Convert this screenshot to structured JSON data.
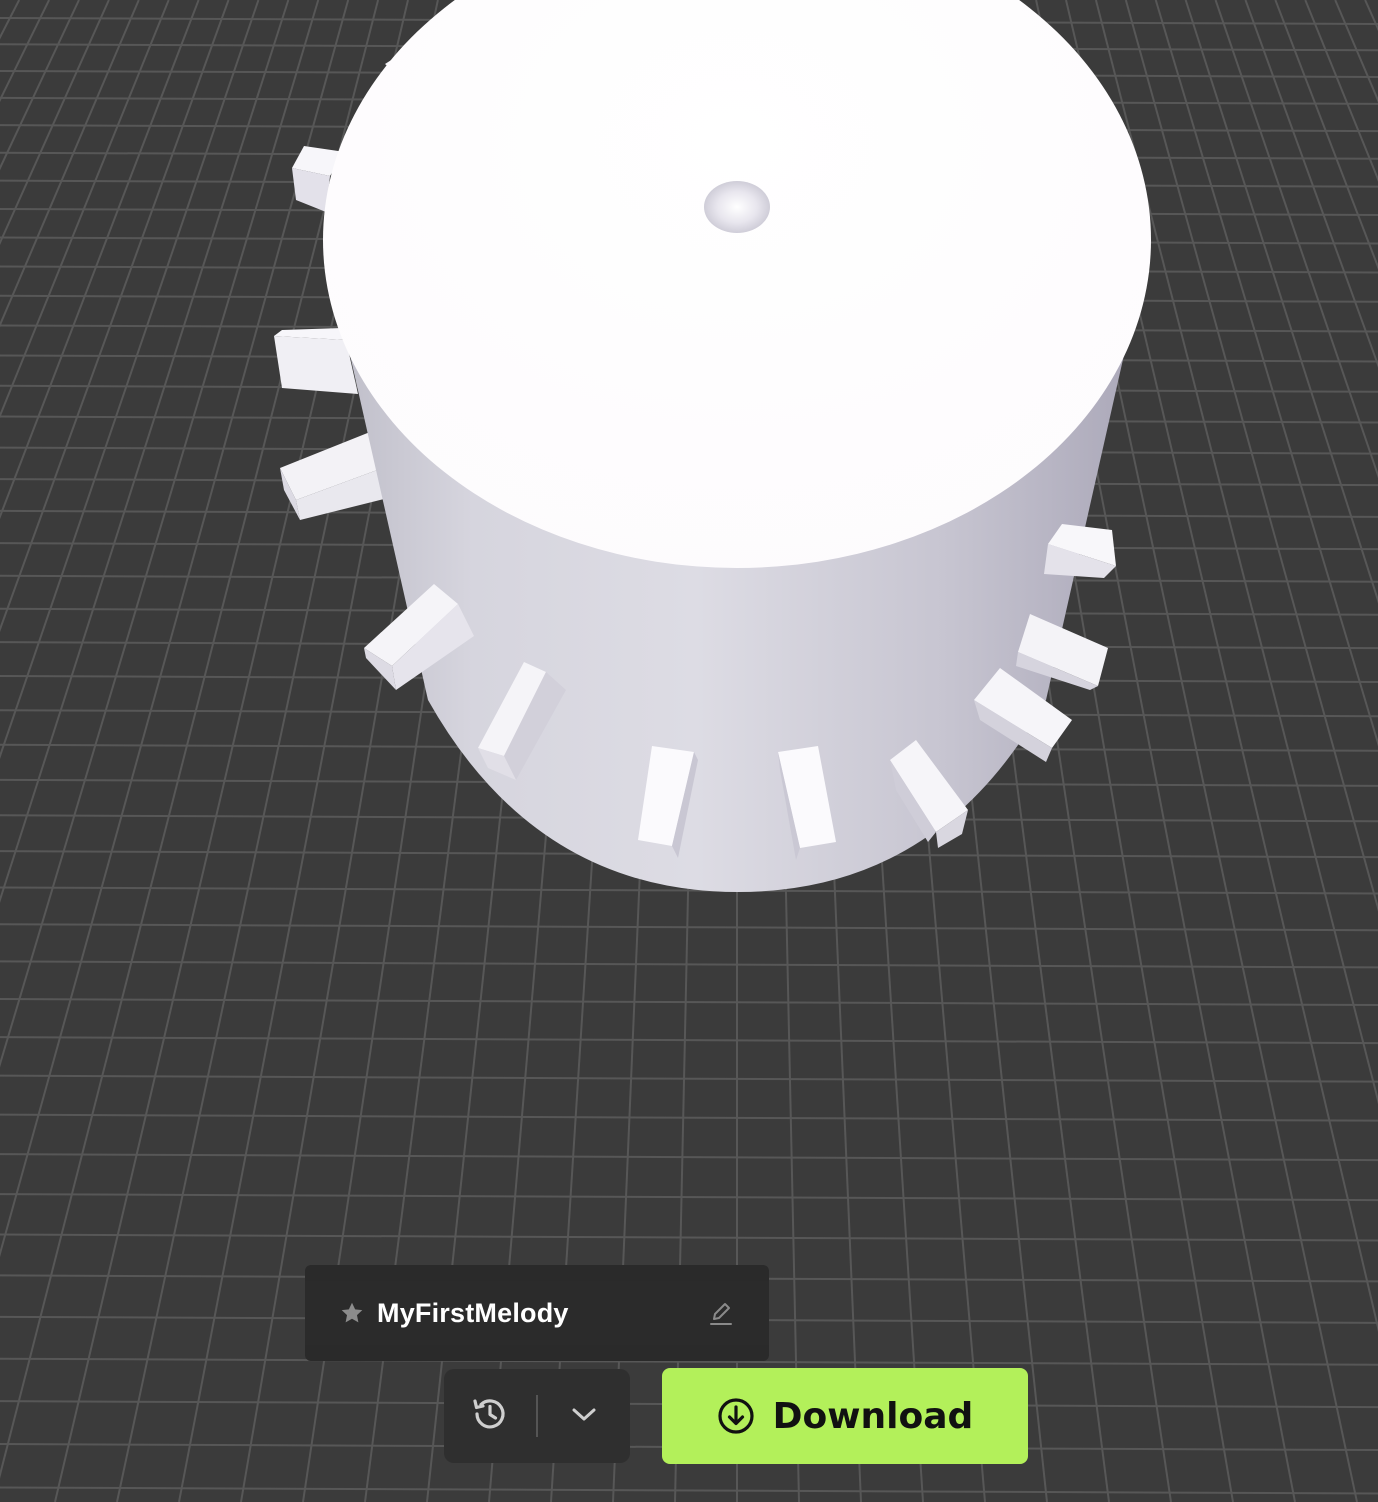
{
  "project": {
    "name": "MyFirstMelody",
    "starred": false
  },
  "toolbar": {
    "download_label": "Download"
  },
  "icons": {
    "favorite": "star-icon",
    "rename": "pencil-edit-icon",
    "history": "history-clock-icon",
    "more": "chevron-down-icon",
    "download": "download-circle-icon"
  },
  "colors": {
    "viewport_background": "#3b3b3b",
    "grid_line": "#575757",
    "model": "#e6e4ea",
    "accent": "#b3f05a",
    "panel": "#2a2a2a"
  }
}
